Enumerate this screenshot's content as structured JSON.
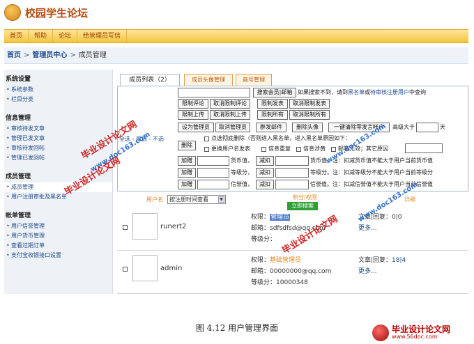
{
  "header": {
    "logo_text": "校园学生论坛"
  },
  "nav": [
    "首页",
    "帮助",
    "论坛",
    "给管理员写信"
  ],
  "breadcrumb": {
    "home": "首页",
    "center": "管理员中心",
    "current": "成员管理"
  },
  "sidebar": {
    "groups": [
      {
        "title": "系统设置",
        "items": [
          "系统参数",
          "栏目分类"
        ]
      },
      {
        "title": "信息管理",
        "items": [
          "审核待发文章",
          "管理已发文章",
          "审核待发回帖",
          "管理已发回帖"
        ]
      },
      {
        "title": "成员管理",
        "items": [
          "成员管理",
          "用户注册审批及黑名单"
        ]
      },
      {
        "title": "帐单管理",
        "items": [
          "用户信誉管理",
          "用户货币管理",
          "查看过期订单",
          "支付宝收银接口设置"
        ]
      }
    ]
  },
  "tabs": [
    "成员列表（2）",
    "成员头像管理",
    "商号管理"
  ],
  "toolbar": {
    "search_button": "搜索会员|邮箱",
    "search_hint_pre": "如果搜索不到，请到",
    "blacklist_link": "黑名单",
    "hint_or": "或",
    "pending_link": "待审核注册用户",
    "search_hint_post": "中查询",
    "row2": [
      "限制评论",
      "取消限制评论",
      "限制发表",
      "取消限制发表"
    ],
    "row3": [
      "限制上传",
      "取消限制上传",
      "限制所有",
      "取消限制所有"
    ],
    "row4": [
      "设为管理员",
      "取消管理员",
      "群发邮件",
      "删除头像",
      "一键清除零发言帐户"
    ],
    "senior_label": "高级大于",
    "days_unit": "天",
    "select_links": [
      "全选",
      "反选",
      "不选"
    ],
    "delete_button": "删除",
    "delete_opt1": "点选彻底删除（否则进入黑名单，进入黑名单原因如下：",
    "delete_opt2": [
      "更换用户名发表",
      "信息重复",
      "信息涉黄",
      "邮箱无效；其它原因"
    ],
    "adjust_rows": [
      {
        "add": "加赠",
        "unit1": "货币值，",
        "sub": "减扣",
        "unit2": "货币值。注：扣减货币值不能大于用户当前货币值"
      },
      {
        "add": "加赠",
        "unit1": "等级分，",
        "sub": "减扣",
        "unit2": "等级分。注：扣减等级分不能大于用户当前等级分"
      },
      {
        "add": "加赠",
        "unit1": "信誉值，",
        "sub": "减扣",
        "unit2": "信誉值。注：扣减信誉值不能大于用户当前信誉值"
      }
    ]
  },
  "list_header": {
    "username": "用户名",
    "sort_select": "按注册时间查看",
    "score_col": "积分/权限",
    "detail_col": "详细",
    "submit": "立即搜索"
  },
  "users": [
    {
      "name": "runert2",
      "role_label": "权限：",
      "role": "管理员",
      "email_label": "邮箱：",
      "email": "sdfsdfsd@qq.com",
      "level_label": "等级分：",
      "level": "",
      "stats_label": "文章|回复：",
      "stats": "0|0",
      "more": "更多..."
    },
    {
      "name": "admin",
      "role_label": "权限：",
      "role": "基础管理员",
      "email_label": "邮箱：",
      "email": "00000000@qq.com",
      "level_label": "等级分：",
      "level": "10000348",
      "stats_label": "文章|回复：",
      "stats": "18|4",
      "more": "更多..."
    }
  ],
  "caption": "图 4.12 用户管理界面",
  "watermarks": [
    "毕业设计论文网",
    "www.doc163.com",
    "毕业设计论文网",
    "www.doc163.com",
    "毕业设计论文网",
    "www.doc163.com"
  ],
  "brand_corner": {
    "title": "毕业设计论文网",
    "url": "www.56doc.com"
  }
}
